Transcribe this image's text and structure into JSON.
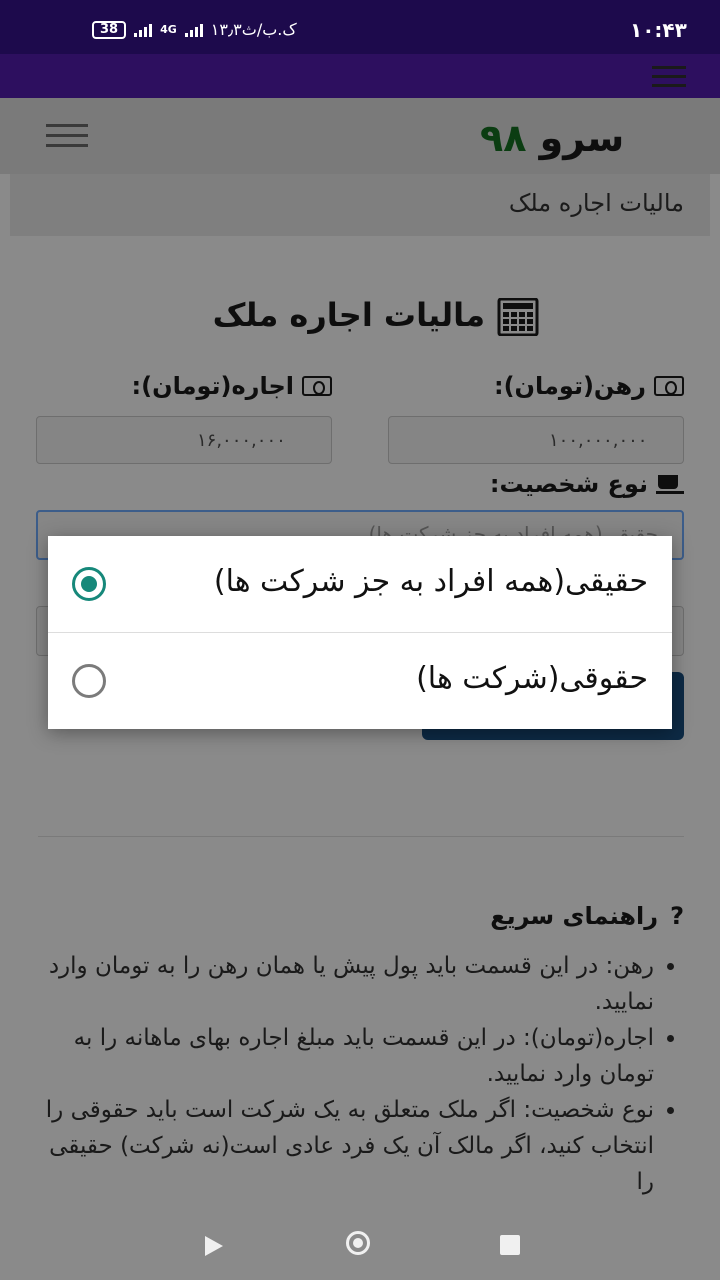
{
  "status_bar": {
    "time": "۱۰:۴۳",
    "speed": "۱۳٫۳ک.ب/ث",
    "network": "4G",
    "battery": "38"
  },
  "header": {
    "logo_text": "سرو",
    "logo_number": "۹۸"
  },
  "breadcrumb": "مالیات اجاره ملک",
  "form": {
    "title": "مالیات اجاره ملک",
    "rahn_label": "رهن(تومان):",
    "rahn_value": "۱۰۰,۰۰۰,۰۰۰",
    "ejare_label": "اجاره(تومان):",
    "ejare_value": "۱۶,۰۰۰,۰۰۰",
    "person_type_label": "نوع شخصیت:",
    "person_type_selected": "حقیقی(همه افراد به جز شرکت ها)"
  },
  "dialog": {
    "options": [
      {
        "label": "حقیقی(همه افراد به جز شرکت ها)",
        "checked": true
      },
      {
        "label": "حقوقی(شرکت ها)",
        "checked": false
      }
    ]
  },
  "guide": {
    "title": "راهنمای سریع",
    "icon": "?",
    "items": [
      "رهن: در این قسمت باید پول پیش یا همان رهن را به تومان وارد نمایید.",
      "اجاره(تومان): در این قسمت باید مبلغ اجاره بهای ماهانه را به تومان وارد نمایید.",
      "نوع شخصیت: اگر ملک متعلق به یک شرکت است باید حقوقی را انتخاب کنید، اگر مالک آن یک فرد عادی است(نه شرکت) حقیقی را"
    ]
  },
  "colors": {
    "status_bar": "#1d0a4c",
    "app_bar": "#2d0f5f",
    "radio_accent": "#16887a",
    "button": "#0d2a45"
  }
}
